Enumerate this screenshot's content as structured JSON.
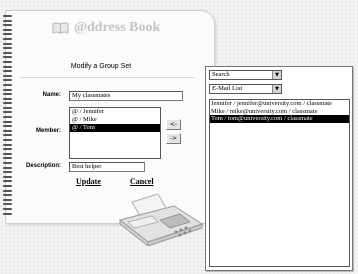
{
  "app": {
    "title": "@ddress Book"
  },
  "form": {
    "heading": "Modify a Group Set",
    "name_label": "Name:",
    "name_value": "My classmates",
    "member_label": "Member:",
    "members": [
      "@ / Jennifer",
      "@ / Mike",
      "@ / Tom"
    ],
    "selected_member": 2,
    "add_arrow": "<-",
    "remove_arrow": "->",
    "description_label": "Description:",
    "description_value": "Best helper",
    "update_label": "Update",
    "cancel_label": "Cancel"
  },
  "search_panel": {
    "mode_select": "Search",
    "list_select": "E-Mail List",
    "results": [
      "Jennifer / jennifer@university.com / classmate",
      "Mike / mike@university.com / classmate",
      "Tom / tom@university.com / classmate"
    ],
    "selected_result": 2
  },
  "icons": {
    "book": "open-book-icon",
    "dropdown": "chevron-down-icon",
    "fax": "fax-machine-illustration"
  },
  "colors": {
    "selection": "#000000",
    "title": "#c4c4c4"
  }
}
